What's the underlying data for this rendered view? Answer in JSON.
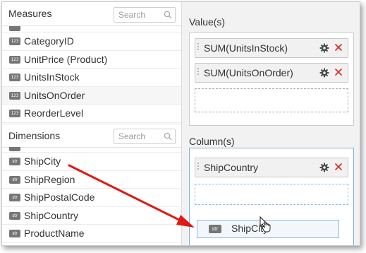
{
  "measures": {
    "title": "Measures",
    "search_placeholder": "Search",
    "badge": "123",
    "items": [
      "CategoryID",
      "UnitPrice (Product)",
      "UnitsInStock",
      "UnitsOnOrder",
      "ReorderLevel"
    ]
  },
  "dimensions": {
    "title": "Dimensions",
    "search_placeholder": "Search",
    "badge": "str",
    "items": [
      "ShipCity",
      "ShipRegion",
      "ShipPostalCode",
      "ShipCountry",
      "ProductName"
    ]
  },
  "values_zone": {
    "title": "Value(s)",
    "items": [
      "SUM(UnitsInStock)",
      "SUM(UnitsOnOrder)"
    ]
  },
  "column_zone": {
    "title": "Column(s)",
    "items": [
      "ShipCountry"
    ]
  },
  "drag_item": {
    "badge": "str",
    "label": "ShipCity"
  },
  "icons": {
    "remove": "close-icon",
    "settings": "gear-icon",
    "search": "search-icon",
    "cursor": "hand-cursor-icon"
  },
  "colors": {
    "remove_icon": "#d9342b",
    "drag_arrow": "#e01818",
    "active_border": "#7fb0e0",
    "badge": "#767676"
  }
}
